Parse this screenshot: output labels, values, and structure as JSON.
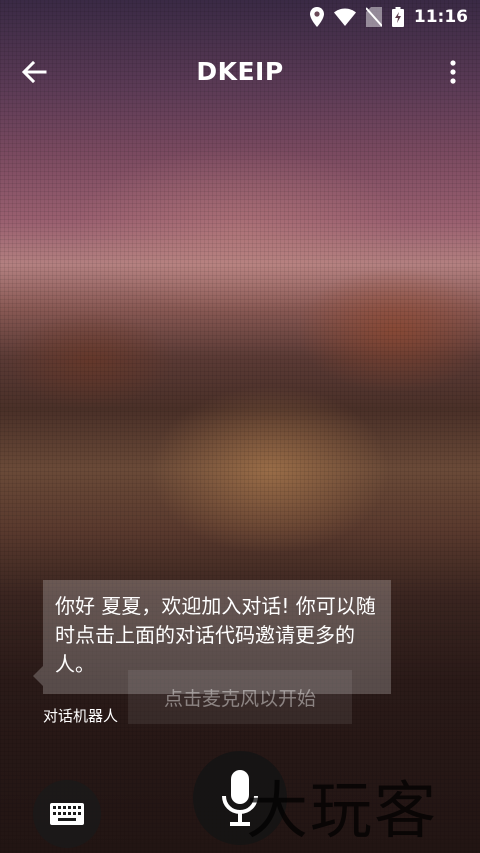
{
  "status_bar": {
    "time": "11:16",
    "icons": [
      "location-icon",
      "wifi-icon",
      "no-sim-icon",
      "battery-charging-icon"
    ]
  },
  "app_bar": {
    "title": "DKEIP",
    "back_icon": "back-arrow-icon",
    "more_icon": "more-vert-icon"
  },
  "chat": {
    "message": "你好 夏夏，欢迎加入对话! 你可以随时点击上面的对话代码邀请更多的人。",
    "sender": "对话机器人",
    "hint": "点击麦克风以开始"
  },
  "controls": {
    "keyboard_icon": "keyboard-icon",
    "mic_icon": "microphone-icon"
  },
  "watermark": {
    "text": "大玩客"
  },
  "colors": {
    "text": "#ffffff",
    "button_bg": "#1a1a1a"
  }
}
